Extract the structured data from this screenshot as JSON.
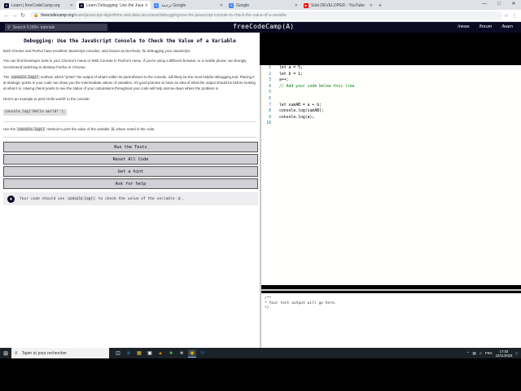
{
  "browser": {
    "tabs": [
      {
        "title": "Learn | freeCodeCamp.org",
        "color": "#0a0a23",
        "glyph": "A"
      },
      {
        "title": "Learn Debugging: Use the JavaScr",
        "color": "#0a0a23",
        "glyph": "A",
        "active": true
      },
      {
        "title": "ترجمة Google",
        "color": "#4285f4",
        "glyph": "G"
      },
      {
        "title": "Google",
        "color": "#4285f4",
        "glyph": "G"
      },
      {
        "title": "Sobi DEVELOPER - YouTube",
        "color": "#ff0000",
        "glyph": "▶"
      }
    ],
    "new_tab": "+",
    "url_host": "freecodecamp.org",
    "url_path": "/learn/javascript-algorithms-and-data-structures/debugging/use-the-javascript-console-to-check-the-value-of-a-variable"
  },
  "fcc": {
    "search_placeholder": "Search 5,000+ tutorials",
    "logo": "freeCodeCamp(A)",
    "links": [
      "/news",
      "/forum",
      "/learn"
    ]
  },
  "challenge": {
    "title": "Debugging: Use the JavaScript Console to Check the Value of a Variable",
    "p1": "Both Chrome and Firefox have excellent JavaScript consoles, also known as DevTools, for debugging your JavaScript.",
    "p2": "You can find Developer tools in your Chrome's menu or Web Console in Firefox's menu. If you're using a different browser, or a mobile phone, we strongly recommend switching to desktop Firefox or Chrome.",
    "p3_pre": "The ",
    "p3_code": "console.log()",
    "p3_post": " method, which \"prints\" the output of what's within its parentheses to the console, will likely be the most helpful debugging tool. Placing it at strategic points in your code can show you the intermediate values of variables. It's good practice to have an idea of what the output should be before looking at what it is. Having check points to see the status of your calculations throughout your code will help narrow down where the problem is.",
    "p4": "Here's an example to print 'Hello world!' to the console:",
    "example_code": "console.log('Hello world!');",
    "task_pre": "Use the ",
    "task_code": "console.log()",
    "task_mid": " method to print the value of the variable ",
    "task_var": "a",
    "task_post": " where noted in the code.",
    "buttons": [
      "Run the Tests",
      "Reset All Code",
      "Get a hint",
      "Ask for help"
    ],
    "test_pre": "Your code should use ",
    "test_code": "console.log()",
    "test_mid": " to check the value of the variable ",
    "test_var": "a",
    "test_post": "."
  },
  "editor": {
    "lines": [
      {
        "n": "1",
        "code": "let a = 5;"
      },
      {
        "n": "2",
        "code": "let b = 1;"
      },
      {
        "n": "3",
        "code": "a++;"
      },
      {
        "n": "4",
        "code": "// Add your code below this line",
        "comment": true
      },
      {
        "n": "5",
        "code": ""
      },
      {
        "n": "6",
        "code": ""
      },
      {
        "n": "7",
        "code": "let sumAB = a + b;"
      },
      {
        "n": "8",
        "code": "console.log(sumAB);"
      },
      {
        "n": "9",
        "code": "console.log(a);"
      },
      {
        "n": "10",
        "code": ""
      }
    ]
  },
  "output": {
    "text": "/**\n* Your test output will go here.\n*/"
  },
  "taskbar": {
    "search_placeholder": "Taper ici pour rechercher",
    "lang": "FRA",
    "time": "17:03",
    "date": "12/11/2019"
  }
}
